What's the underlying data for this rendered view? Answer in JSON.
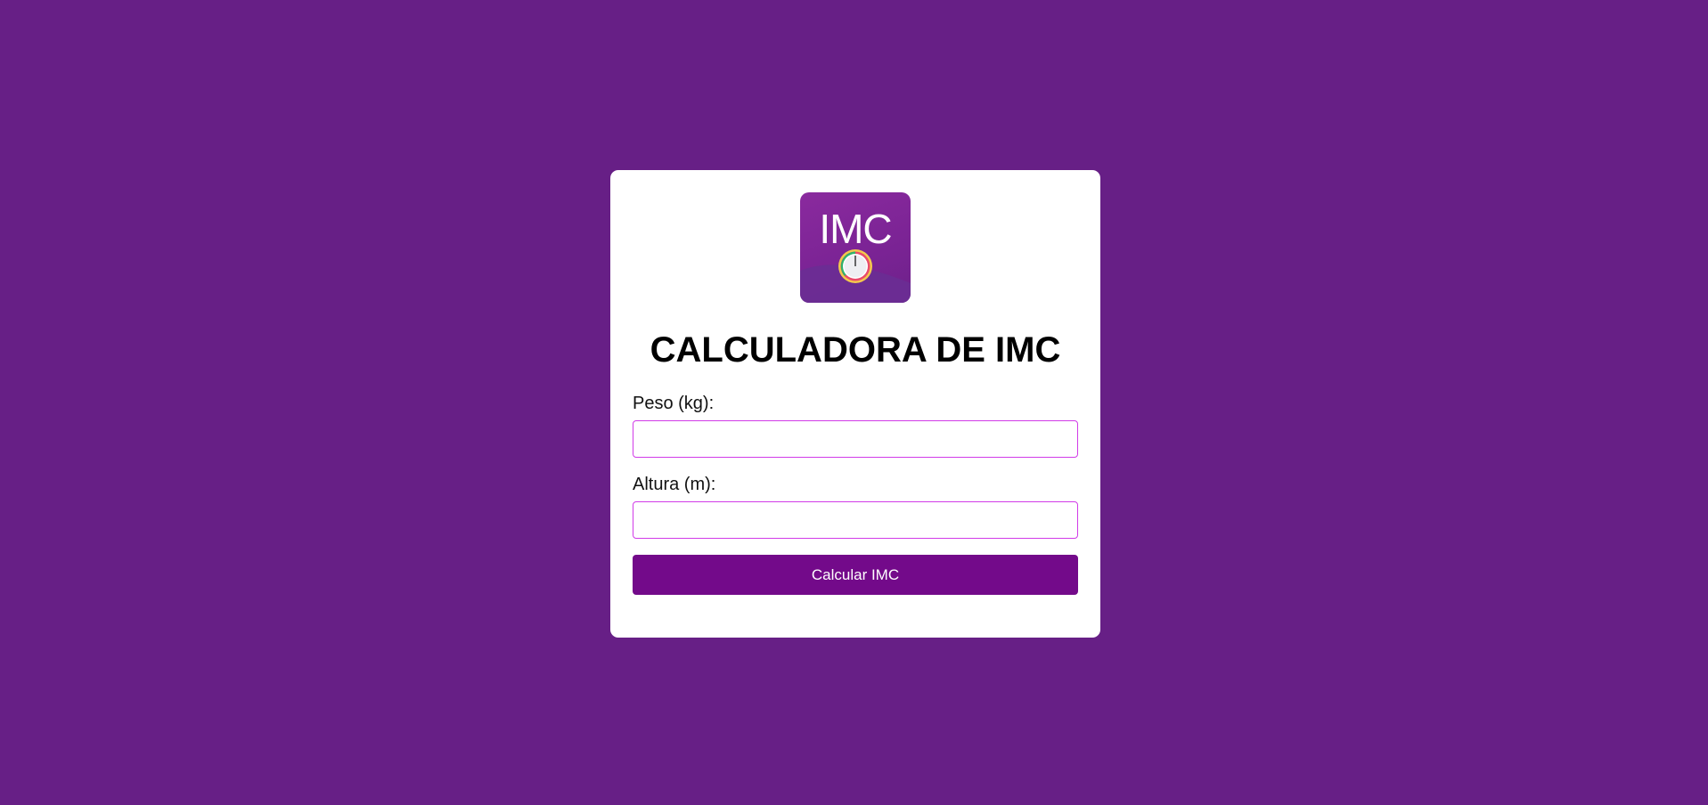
{
  "app": {
    "logo_text": "IMC",
    "title": "CALCULADORA DE IMC"
  },
  "form": {
    "weight_label": "Peso (kg):",
    "weight_value": "",
    "weight_placeholder": "",
    "height_label": "Altura (m):",
    "height_value": "",
    "height_placeholder": "",
    "submit_label": "Calcular IMC"
  },
  "icons": {
    "logo": "bmi-gauge-icon"
  },
  "colors": {
    "page_background": "#671f86",
    "card_background": "#ffffff",
    "button_background": "#730a8a",
    "input_border": "#d13be8",
    "logo_background": "#8a2a9e"
  }
}
